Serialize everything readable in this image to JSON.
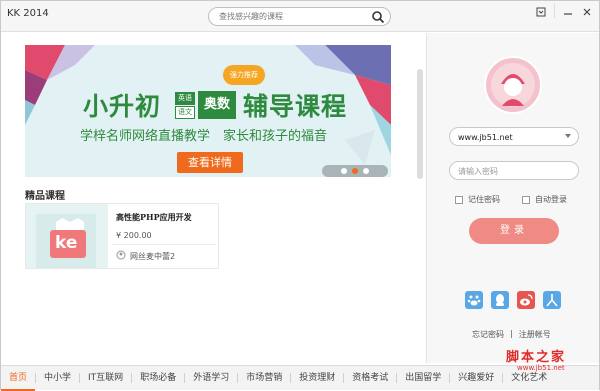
{
  "window": {
    "title": "KK 2014"
  },
  "search": {
    "placeholder": "查找感兴趣的课程"
  },
  "banner": {
    "title_part1": "小升初",
    "tag_en": "英语",
    "tag_cn": "语文",
    "tag_ao": "奥数",
    "title_part2": "辅导课程",
    "hot_badge": "强力推荐",
    "subtitle": "学梓名师网络直播教学　家长和孩子的福音",
    "button": "查看详情",
    "dots": 3,
    "active_dot": 1
  },
  "section": {
    "title": "精品课程"
  },
  "course": {
    "thumb_text": "ke",
    "name": "高性能PHP应用开发",
    "price": "¥ 200.00",
    "teacher": "网丝麦中蕾2"
  },
  "login": {
    "username_value": "www.jb51.net",
    "password_placeholder": "请输入密码",
    "remember_label": "记住密码",
    "auto_label": "自动登录",
    "button": "登录",
    "forgot": "忘记密码",
    "separator": "|",
    "register": "注册帐号"
  },
  "nav": [
    "首页",
    "中小学",
    "IT互联网",
    "职场必备",
    "外语学习",
    "市场营销",
    "投资理财",
    "资格考试",
    "出国留学",
    "兴趣爱好",
    "文化艺术"
  ],
  "watermark": {
    "line1": "脚本之家",
    "line2": "www.jb51.net"
  },
  "colors": {
    "accent": "#f06a1e",
    "green": "#2d8a3e",
    "login": "#f08a84"
  }
}
